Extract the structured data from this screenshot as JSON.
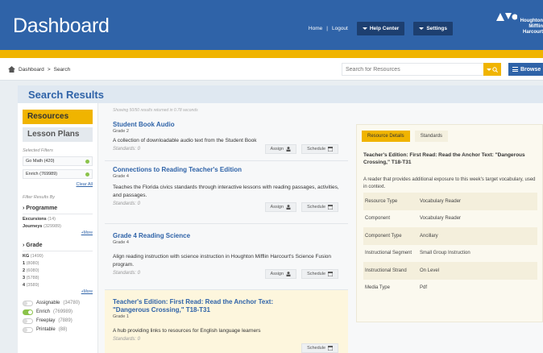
{
  "header": {
    "title": "Dashboard",
    "home": "Home",
    "separator": "|",
    "logout": "Logout",
    "help_center": "Help Center",
    "settings": "Settings",
    "logo_lines": [
      "Houghton",
      "Mifflin",
      "Harcourt"
    ]
  },
  "breadcrumb": {
    "home": "Dashboard",
    "separator": ">",
    "current": "Search"
  },
  "search": {
    "placeholder": "Search for Resources",
    "browse": "Browse"
  },
  "panel": {
    "title": "Search Results"
  },
  "sidebar": {
    "tab_resources": "Resources",
    "tab_lesson_plans": "Lesson Plans",
    "selected_filters_label": "Selected Filters",
    "selected_filters": [
      "Go Math (420)",
      "Enrich (769989)"
    ],
    "clear_all": "Clear All",
    "filter_by_label": "Filter Results By",
    "programme": {
      "title": "Programme",
      "items": [
        {
          "name": "Excursions",
          "count": "(14)"
        },
        {
          "name": "Journeys",
          "count": "(329989)"
        }
      ],
      "more": "+More"
    },
    "grade": {
      "title": "Grade",
      "items": [
        {
          "name": "KG",
          "count": "(1499)"
        },
        {
          "name": "1",
          "count": "(8080)"
        },
        {
          "name": "2",
          "count": "(6080)"
        },
        {
          "name": "3",
          "count": "(5788)"
        },
        {
          "name": "4",
          "count": "(3589)"
        }
      ],
      "more": "+More"
    },
    "toggles": [
      {
        "label": "Assignable",
        "count": "(34780)",
        "on": false
      },
      {
        "label": "Enrich",
        "count": "(769989)",
        "on": true
      },
      {
        "label": "Freeplay",
        "count": "(7889)",
        "on": false
      },
      {
        "label": "Printable",
        "count": "(88)",
        "on": false
      }
    ]
  },
  "results": {
    "showing": "Showing 50/50 results returned in 0.78 seconds",
    "assign_label": "Assign",
    "schedule_label": "Schedule",
    "items": [
      {
        "title": "Student Book Audio",
        "grade": "Grade 2",
        "description": "A collection of downloadable audio text from the Student Book",
        "standards": "Standards: 0"
      },
      {
        "title": "Connections to Reading Teacher's Edition",
        "grade": "Grade 4",
        "description": "Teaches the Florida civics standards through interactive lessons with reading passages, activities, and passages.",
        "standards": "Standards: 0"
      },
      {
        "title": "Grade 4 Reading Science",
        "grade": "Grade 4",
        "description": "Align reading instruction with science instruction in Houghton Mifflin Harcourt's Science Fusion program.",
        "standards": "Standards: 0"
      },
      {
        "title": "Teacher's Edition: First Read: Read the Anchor Text: \"Dangerous Crossing,\" T18-T31",
        "grade": "Grade 1",
        "description": "A hub providing links to resources for English language learners",
        "standards": "Standards: 0"
      }
    ]
  },
  "details": {
    "tab_details": "Resource Details",
    "tab_standards": "Standards",
    "title": "Teacher's Edition: First Read: Read the Anchor Text: \"Dangerous Crossing,\" T18-T31",
    "description": "A reader that provides additional exposure to this week's target vocabulary, used in context.",
    "rows": [
      {
        "key": "Resource Type",
        "value": "Vocabulary Reader"
      },
      {
        "key": "Component",
        "value": "Vocabulary Reader"
      },
      {
        "key": "Component Type",
        "value": "Ancillary"
      },
      {
        "key": "Instructional Segment",
        "value": "Small Group Instruction"
      },
      {
        "key": "Instructional Strand",
        "value": "On Level"
      },
      {
        "key": "Media Type",
        "value": "Pdf"
      }
    ]
  },
  "colors": {
    "brand_blue": "#2f63a8",
    "accent_yellow": "#f0b400",
    "toggle_green": "#8bc34a"
  }
}
